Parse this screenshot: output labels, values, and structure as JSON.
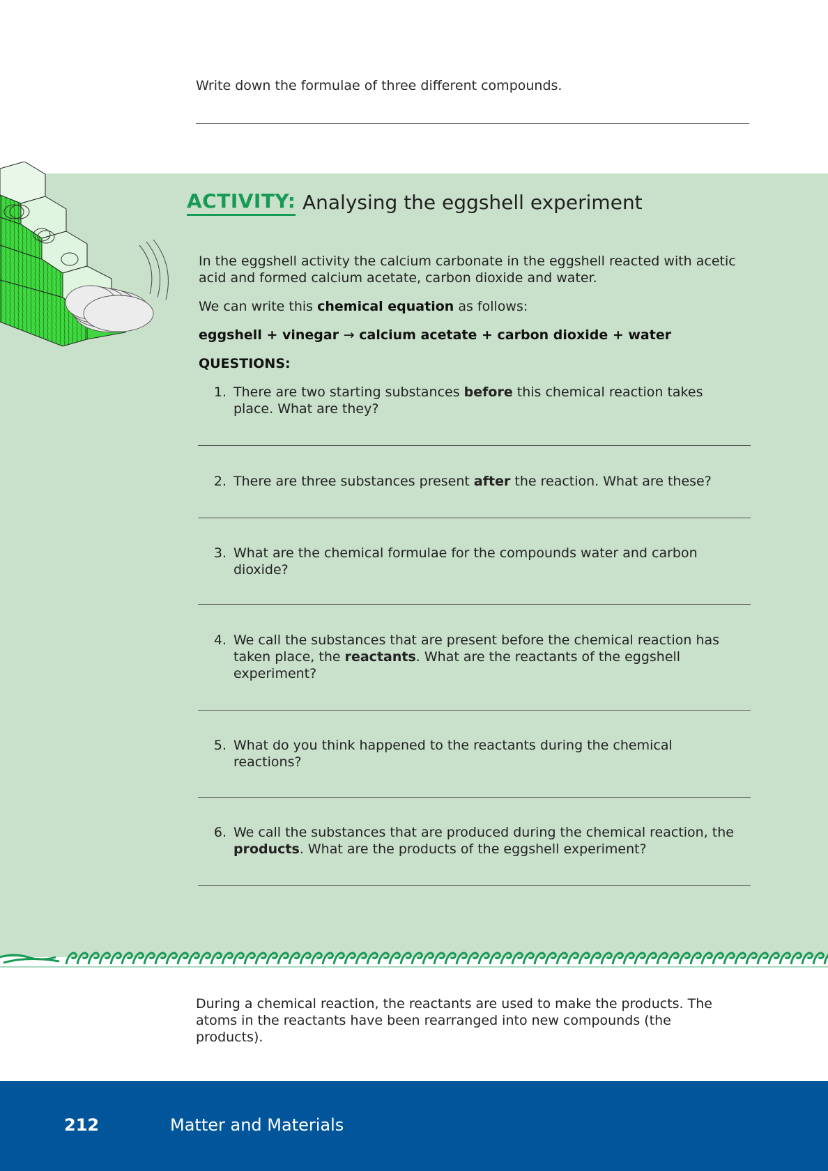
{
  "top_prompt": "Write down the formulae of three different compounds.",
  "activity": {
    "label": "ACTIVITY:",
    "title": "Analysing the eggshell experiment",
    "intro_line1": "In the eggshell activity the calcium carbonate in the eggshell reacted with acetic",
    "intro_line2": "acid and formed calcium acetate, carbon dioxide and water.",
    "eq_intro_pre": "We can write this ",
    "eq_intro_bold": "chemical equation",
    "eq_intro_post": " as follows:",
    "equation_left": "eggshell + vinegar ",
    "equation_arrow": "→",
    "equation_right": " calcium acetate + carbon dioxide + water",
    "questions_heading": "QUESTIONS:"
  },
  "questions": [
    {
      "num": "1.",
      "line1_pre": "There are two starting substances ",
      "line1_bold": "before",
      "line1_post": " this chemical reaction takes",
      "line2": "place. What are they?"
    },
    {
      "num": "2.",
      "line1_pre": "There are three substances present ",
      "line1_bold": "after",
      "line1_post": " the reaction. What are these?"
    },
    {
      "num": "3.",
      "line1": "What are the chemical formulae for the compounds water and carbon",
      "line2": "dioxide?"
    },
    {
      "num": "4.",
      "line1": "We call the substances that are present before the chemical reaction has",
      "line2_pre": "taken place, the ",
      "line2_bold": "reactants",
      "line2_post": ". What are the reactants of the eggshell",
      "line3": "experiment?"
    },
    {
      "num": "5.",
      "line1": "What do you think happened to the reactants during the chemical",
      "line2": "reactions?"
    },
    {
      "num": "6.",
      "line1": "We call the substances that are produced during the chemical reaction, the",
      "line2_bold": "products",
      "line2_post": ". What are the products of the eggshell experiment?"
    }
  ],
  "conclusion": {
    "line1": "During a chemical reaction, the reactants are used to make the products. The",
    "line2": "atoms in the reactants have been rearranged into new compounds (the",
    "line3": "products)."
  },
  "footer": {
    "page_number": "212",
    "book_title": "Matter and Materials"
  },
  "colors": {
    "activity_green": "#179a55",
    "box_background": "#c9e0cb",
    "footer_blue": "#00559b"
  }
}
